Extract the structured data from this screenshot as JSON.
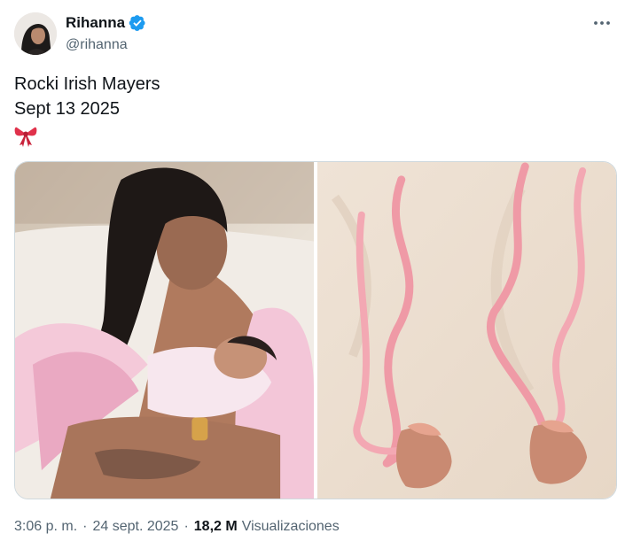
{
  "author": {
    "display_name": "Rihanna",
    "handle": "@rihanna",
    "avatar_icon": "avatar-photo",
    "verified_color": "#1d9bf0"
  },
  "tweet": {
    "lines": [
      "Rocki Irish Mayers",
      "Sept 13 2025"
    ],
    "emoji": "ribbon-emoji"
  },
  "media": {
    "photos": [
      {
        "subject": "mother-holding-newborn-photo"
      },
      {
        "subject": "pink-ribbons-baby-shoes-photo"
      }
    ]
  },
  "meta": {
    "time": "3:06 p. m.",
    "date": "24 sept. 2025",
    "separator": "·",
    "views_count": "18,2 M",
    "views_label": "Visualizaciones"
  },
  "colors": {
    "text_primary": "#0f1419",
    "text_secondary": "#536471",
    "border": "#cfd9de"
  }
}
